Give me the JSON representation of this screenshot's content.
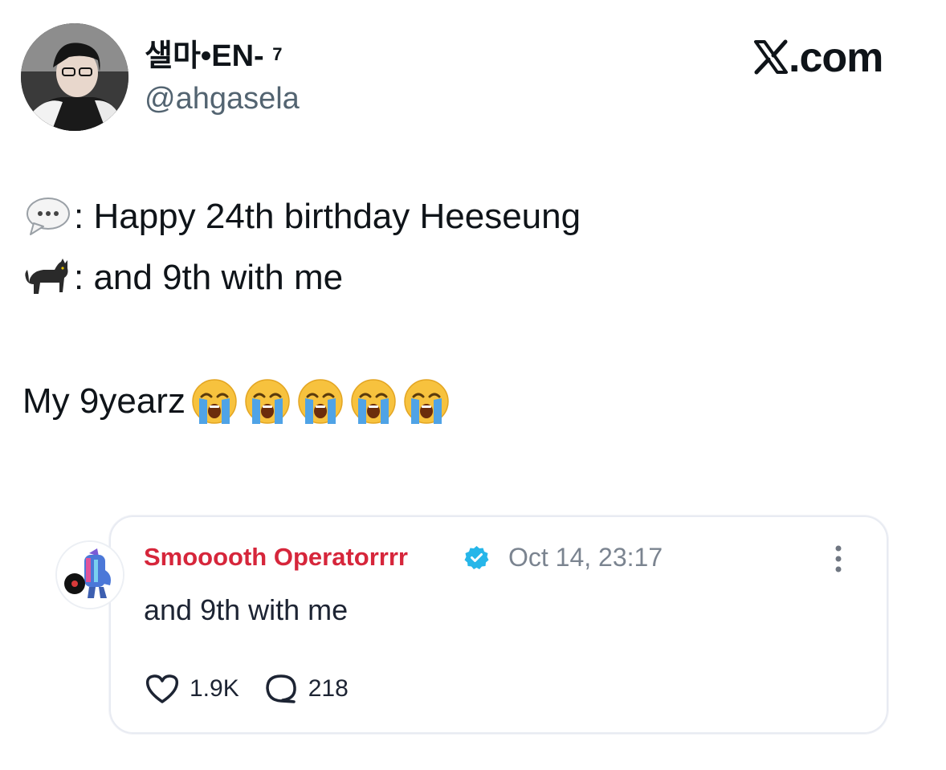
{
  "author": {
    "display_name": "샐마•EN-",
    "superscript": "7",
    "handle": "@ahgasela",
    "avatar_icon": "profile-photo"
  },
  "watermark": {
    "text": ".com",
    "logo_icon": "x-logo-icon"
  },
  "tweet": {
    "line1_icon": "speech-bubble-icon",
    "line1_text": ": Happy 24th birthday Heeseung",
    "line2_icon": "black-cat-icon",
    "line2_text": ": and 9th with me",
    "line3_text": "My 9yearz",
    "line3_emoji_icon": "loudly-crying-face-icon",
    "line3_emoji_count": 5
  },
  "quoted_post": {
    "avatar_icon": "cartoon-avatar-icon",
    "name": "Smooooth Operatorrrr",
    "verified_icon": "verified-badge-icon",
    "timestamp": "Oct 14, 23:17",
    "text": "and 9th with me",
    "likes": "1.9K",
    "replies": "218",
    "accent_color": "#d6263b",
    "verified_color": "#1da1f2"
  }
}
